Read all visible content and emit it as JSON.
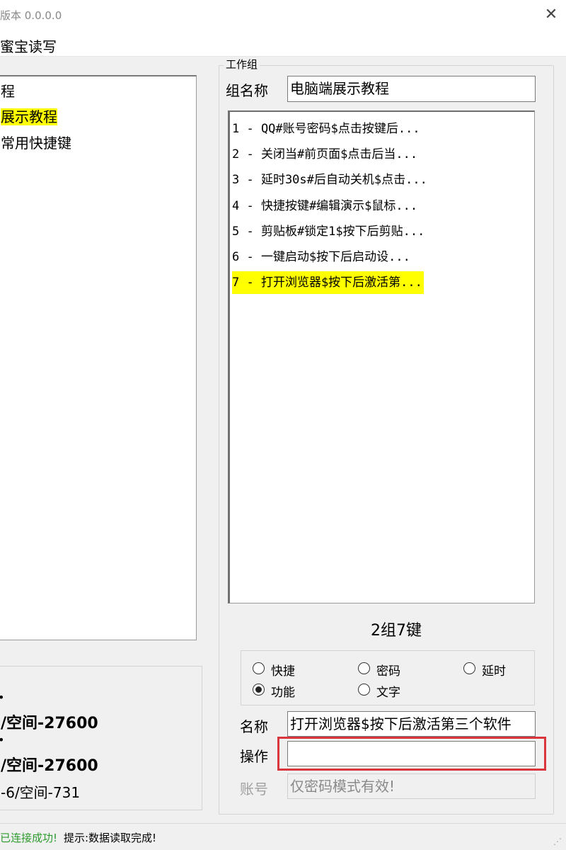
{
  "window": {
    "title": "版本 0.0.0.0",
    "close_glyph": "✕"
  },
  "menu": {
    "item": "蜜宝读写"
  },
  "tree": {
    "items": [
      {
        "label": "程",
        "selected": false
      },
      {
        "label": "展示教程",
        "selected": true
      },
      {
        "label": "常用快捷键",
        "selected": false
      }
    ]
  },
  "info": {
    "bullet": "•",
    "lines": [
      "/空间-27600",
      "/空间-27600",
      "-6/空间-731"
    ]
  },
  "group": {
    "legend": "工作组",
    "name_label": "组名称",
    "name_value": "电脑端展示教程",
    "keys": [
      "1 - QQ#账号密码$点击按键后...",
      "2 - 关闭当#前页面$点击后当...",
      "3 - 延时30s#后自动关机$点击...",
      "4 - 快捷按键#编辑演示$鼠标...",
      "5 - 剪贴板#锁定1$按下后剪贴...",
      "6 -  一键启动$按下后启动设...",
      "7 - 打开浏览器$按下后激活第..."
    ],
    "selected_index": 6,
    "count": "2组7键"
  },
  "mode": {
    "options": [
      {
        "label": "快捷",
        "checked": false
      },
      {
        "label": "密码",
        "checked": false
      },
      {
        "label": "延时",
        "checked": false
      },
      {
        "label": "功能",
        "checked": true
      },
      {
        "label": "文字",
        "checked": false
      }
    ]
  },
  "fields": {
    "name_label": "名称",
    "name_value": "打开浏览器$按下后激活第三个软件",
    "op_label": "操作",
    "op_value": "",
    "account_label": "账号",
    "account_value": "仅密码模式有效!"
  },
  "status": {
    "connection": "已连接成功!",
    "message": "提示:数据读取完成!"
  },
  "colors": {
    "highlight": "#ffff00",
    "annotation": "#d9363e",
    "status_ok": "#2e9a2e"
  }
}
